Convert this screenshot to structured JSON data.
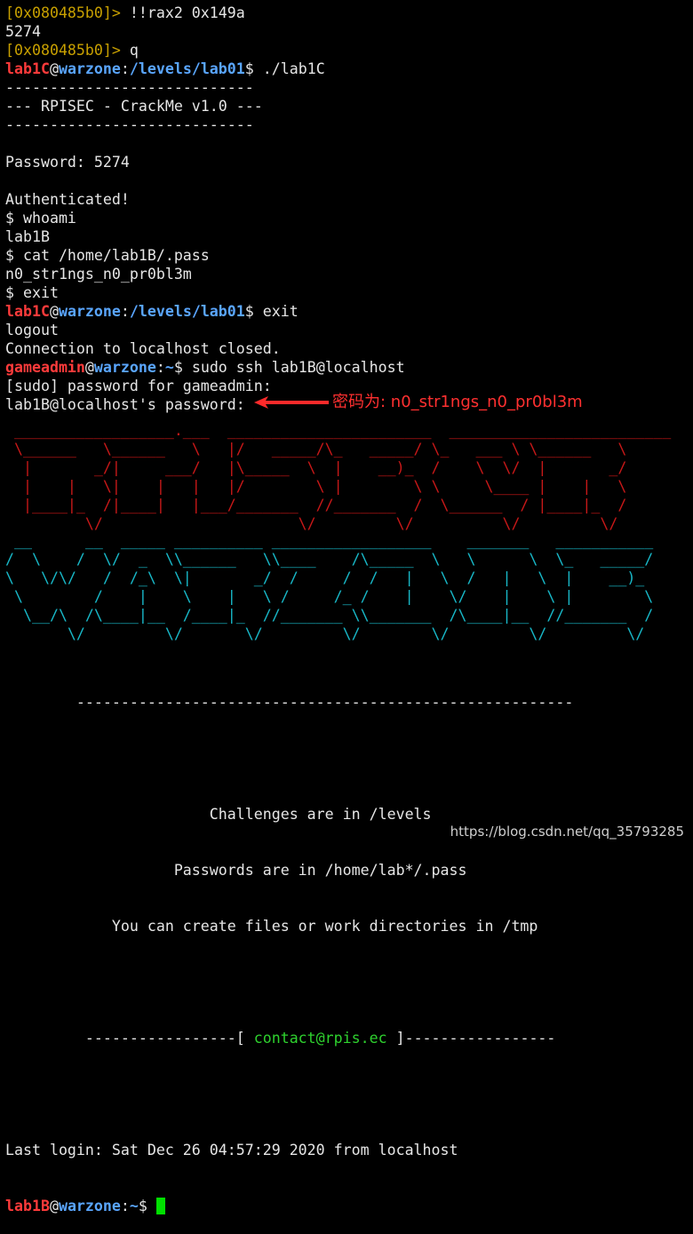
{
  "terminal": {
    "lines": [
      {
        "kind": "gdb",
        "prompt": "[0x080485b0]>",
        "cmd": " !!rax2 0x149a"
      },
      {
        "kind": "text",
        "text": "5274"
      },
      {
        "kind": "gdb",
        "prompt": "[0x080485b0]>",
        "cmd": " q"
      },
      {
        "kind": "shell",
        "user": "lab1C",
        "host": "warzone",
        "path": "/levels/lab01",
        "cmd": "$ ./lab1C"
      },
      {
        "kind": "text",
        "text": "----------------------------"
      },
      {
        "kind": "text",
        "text": "--- RPISEC - CrackMe v1.0 ---"
      },
      {
        "kind": "text",
        "text": "----------------------------"
      },
      {
        "kind": "text",
        "text": ""
      },
      {
        "kind": "text",
        "text": "Password: 5274"
      },
      {
        "kind": "text",
        "text": ""
      },
      {
        "kind": "text",
        "text": "Authenticated!"
      },
      {
        "kind": "text",
        "text": "$ whoami"
      },
      {
        "kind": "text",
        "text": "lab1B"
      },
      {
        "kind": "text",
        "text": "$ cat /home/lab1B/.pass"
      },
      {
        "kind": "text",
        "text": "n0_str1ngs_n0_pr0bl3m"
      },
      {
        "kind": "text",
        "text": "$ exit"
      },
      {
        "kind": "shell",
        "user": "lab1C",
        "host": "warzone",
        "path": "/levels/lab01",
        "cmd": "$ exit"
      },
      {
        "kind": "text",
        "text": "logout"
      },
      {
        "kind": "text",
        "text": "Connection to localhost closed."
      },
      {
        "kind": "shell",
        "user": "gameadmin",
        "host": "warzone",
        "path": "~",
        "cmd": "$ sudo ssh lab1B@localhost"
      },
      {
        "kind": "text",
        "text": "[sudo] password for gameadmin:"
      },
      {
        "kind": "text",
        "text": "lab1B@localhost's password:"
      }
    ],
    "banner_red": [
      " __________________.___  _______________________  _________________________",
      " \\______   \\______   \\   |/   _____/\\_   _____/ \\_   ___ \\ \\______   \\",
      "  |       _/|     ___/   |\\_____  \\  |    __)_  /    \\  \\/  |       _/",
      "  |    |   \\|    |   |   |/        \\ |        \\ \\     \\____ |    |   \\",
      "  |____|_  /|____|   |___/_______  //_______  /  \\______  / |____|_  /",
      "         \\/                      \\/         \\/          \\/         \\/"
    ],
    "banner_cyan": [
      " __      __  _____ __________ __________________    _______   ___________",
      "/  \\    /  \\/  _  \\\\______   \\\\____    /\\_____  \\   \\      \\  \\_   _____/",
      "\\   \\/\\/   /  /_\\  \\|       _/  /     /  /   |   \\  /   |   \\  |    __)_",
      " \\        /    |    \\    |   \\ /     /_ /    |    \\/    |    \\ |        \\",
      "  \\__/\\  /\\____|__  /____|_  //_______ \\\\_______  /\\____|__  //_______  /",
      "       \\/         \\/       \\/         \\/        \\/         \\/         \\/"
    ],
    "motd": {
      "rule": "        --------------------------------------------------------",
      "line1": "                       Challenges are in /levels",
      "line2": "                   Passwords are in /home/lab*/.pass",
      "line3": "            You can create files or work directories in /tmp",
      "contact_pre": "         -----------------[ ",
      "contact": "contact@rpis.ec",
      "contact_post": " ]-----------------"
    },
    "last_login": "Last login: Sat Dec 26 04:57:29 2020 from localhost",
    "final_prompt": {
      "user": "lab1B",
      "host": "warzone",
      "path": "~",
      "cmd": "$ "
    }
  },
  "annotation": "密码为: n0_str1ngs_n0_pr0bl3m",
  "watermark": "https://blog.csdn.net/qq_35793285",
  "colors": {
    "gdb_prompt": "#c8a000",
    "user": "#ff3b3b",
    "path": "#5aa6ff",
    "banner_red": "#c81818",
    "banner_cyan": "#18b8c8",
    "cursor": "#00e000",
    "annotation": "#ff3030"
  }
}
